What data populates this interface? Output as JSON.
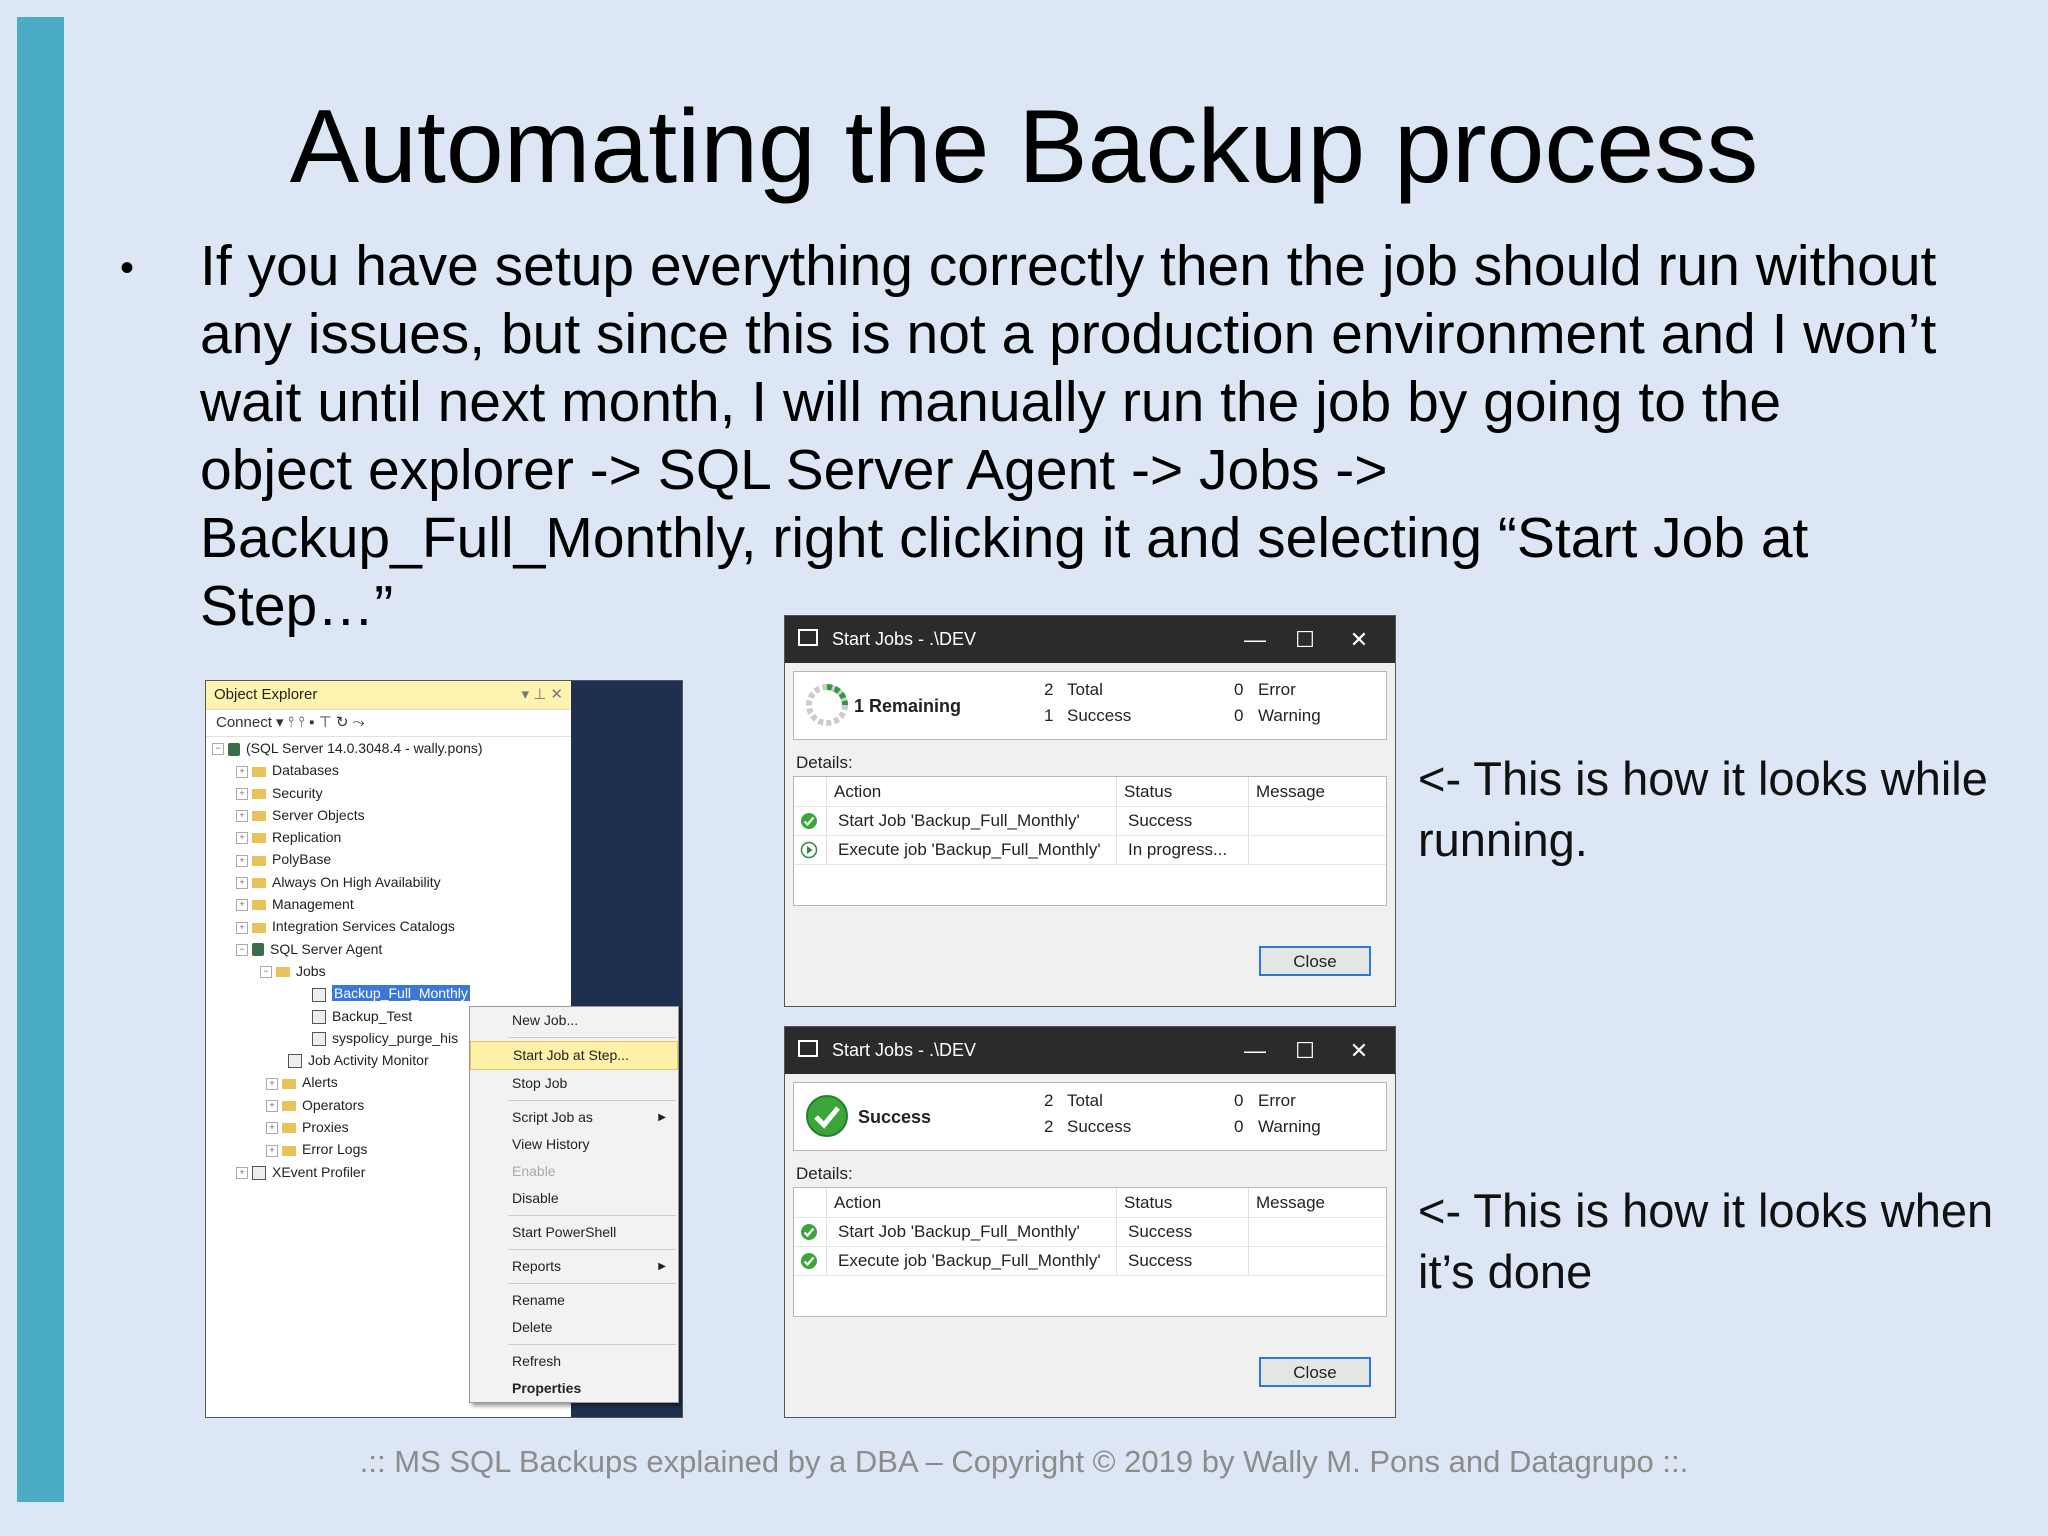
{
  "slide": {
    "title": "Automating the Backup process",
    "bullet": "If you have setup everything correctly then the job should run without any issues, but since this is not a production environment and I won’t wait until next month, I will manually run the job by going to the object explorer -> SQL Server Agent -> Jobs -> Backup_Full_Monthly, right clicking it and selecting “Start Job at Step…”",
    "note_running": "<- This is how it looks while running.",
    "note_done": "<- This is how it looks when it’s done",
    "footer": ".:: MS SQL Backups explained by a DBA – Copyright © 2019 by Wally M. Pons and Datagrupo ::.",
    "accent_color": "#4bacc6"
  },
  "object_explorer": {
    "title": "Object Explorer",
    "pins": "▾ ⊥ ✕",
    "toolbar": "Connect ▾ ⫯ ⫯ ▪ ⊤ ↻ ⤳",
    "server": "(SQL Server 14.0.3048.4 - wally.pons)",
    "nodes": [
      "Databases",
      "Security",
      "Server Objects",
      "Replication",
      "PolyBase",
      "Always On High Availability",
      "Management",
      "Integration Services Catalogs"
    ],
    "agent": "SQL Server Agent",
    "jobs_folder": "Jobs",
    "jobs": [
      "Backup_Full_Monthly",
      "Backup_Test",
      "syspolicy_purge_his"
    ],
    "agent_children": [
      "Job Activity Monitor",
      "Alerts",
      "Operators",
      "Proxies",
      "Error Logs"
    ],
    "xevent": "XEvent Profiler"
  },
  "context_menu": {
    "items": [
      "New Job...",
      "Start Job at Step...",
      "Stop Job",
      "Script Job as",
      "View History",
      "Enable",
      "Disable",
      "Start PowerShell",
      "Reports",
      "Rename",
      "Delete",
      "Refresh",
      "Properties"
    ]
  },
  "dialog_running": {
    "title": "Start Jobs - .\\DEV",
    "summary_label": "1  Remaining",
    "total_n": "2",
    "total_label": "Total",
    "success_n": "1",
    "success_label": "Success",
    "error_n": "0",
    "error_label": "Error",
    "warning_n": "0",
    "warning_label": "Warning",
    "details_label": "Details:",
    "columns": [
      "Action",
      "Status",
      "Message"
    ],
    "rows": [
      {
        "action": "Start Job 'Backup_Full_Monthly'",
        "status": "Success",
        "message": ""
      },
      {
        "action": "Execute job 'Backup_Full_Monthly'",
        "status": "In progress...",
        "message": ""
      }
    ],
    "close_label": "Close"
  },
  "dialog_done": {
    "title": "Start Jobs - .\\DEV",
    "summary_label": "Success",
    "total_n": "2",
    "total_label": "Total",
    "success_n": "2",
    "success_label": "Success",
    "error_n": "0",
    "error_label": "Error",
    "warning_n": "0",
    "warning_label": "Warning",
    "details_label": "Details:",
    "columns": [
      "Action",
      "Status",
      "Message"
    ],
    "rows": [
      {
        "action": "Start Job 'Backup_Full_Monthly'",
        "status": "Success",
        "message": ""
      },
      {
        "action": "Execute job 'Backup_Full_Monthly'",
        "status": "Success",
        "message": ""
      }
    ],
    "close_label": "Close"
  }
}
